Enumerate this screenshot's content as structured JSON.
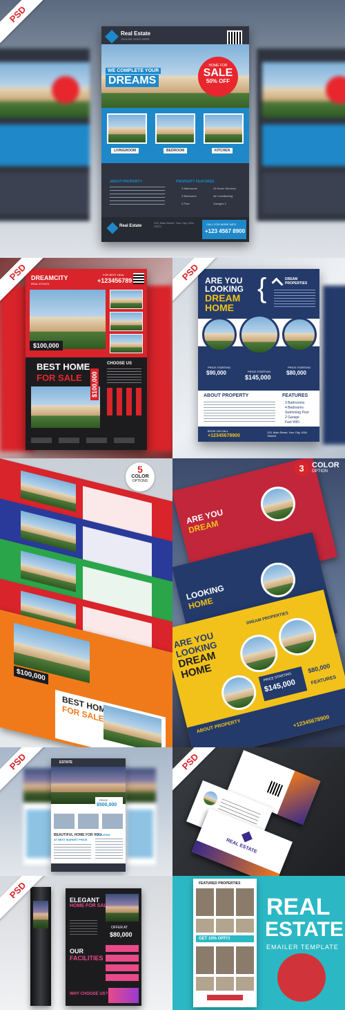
{
  "panel1": {
    "badge": "PSD",
    "logo_name": "Real Estate",
    "logo_tagline": "TAGLINE GOES HERE",
    "headline_small": "WE COMPLETE YOUR",
    "headline_big": "DREAMS",
    "sale_small": "HOME FOR",
    "sale_big": "SALE",
    "sale_off": "50% OFF",
    "rooms": [
      "LIVINGROOM",
      "BEDROOM",
      "KITCHEN"
    ],
    "about_title": "ABOUT PROPERTY",
    "features_title": "PROPERTY FEATURES",
    "features": [
      "3 Bathrooms",
      "24 Hours Services",
      "2 Bedrooms",
      "Air Conditioning",
      "2 Pool",
      "Garages 2"
    ],
    "footer_logo": "Real Estate",
    "address": "123, Main Street, Your City, USA 70071",
    "phone_label": "CALL FOR MORE INFO",
    "phone": "+123 4567 8900",
    "colors": {
      "dark": "#2f3440",
      "accent": "#1e88c9",
      "sale": "#e8262d"
    }
  },
  "panel2": {
    "badge": "PSD",
    "brand": "DREAMCITY",
    "brand_sub": "REAL ESTATE",
    "call_label": "FOR BEST DEAL",
    "phone": "+123456789",
    "price": "$100,000",
    "headline_1": "BEST HOME",
    "headline_2": "FOR SALE",
    "side_price": "$100,000",
    "section": "CHOOSE US",
    "colors": {
      "red": "#d8242a",
      "dark": "#1c1c1f"
    }
  },
  "panel3": {
    "badge": "PSD",
    "headline": [
      "ARE YOU",
      "LOOKING",
      "DREAM",
      "HOME"
    ],
    "brand": "DREAM PROPERTIES",
    "prices": [
      {
        "label": "PRICE STARTING",
        "value": "$90,000"
      },
      {
        "label": "PRICE STARTING",
        "value": "$145,000"
      },
      {
        "label": "PRICE STARTING",
        "value": "$80,000"
      }
    ],
    "about_title": "ABOUT PROPERTY",
    "features_title": "FEATURES",
    "features": [
      "3 Bathrooms",
      "4 Bedrooms",
      "Swimming Pool",
      "2 Garage",
      "Fast WiFi"
    ],
    "book_label": "BOOK ON CALL",
    "phone": "+12345678900",
    "address": "123, Main Street, Your City, USA 788423",
    "colors": {
      "navy": "#233a6b",
      "gold": "#f2c21b"
    }
  },
  "panel4": {
    "options_number": "5",
    "options_line1": "COLOR",
    "options_line2": "OPTIONS",
    "headline_1": "BEST HOME",
    "headline_2": "FOR SALE",
    "price": "$100,000",
    "flyer_colors": [
      "#d8242a",
      "#2a3a9a",
      "#2aa54a",
      "#d8242a",
      "#f07a1a"
    ]
  },
  "panel5": {
    "options_number": "3",
    "options_line1": "COLOR",
    "options_line2": "OPTION",
    "headline": [
      "ARE YOU",
      "LOOKING",
      "DREAM",
      "HOME"
    ],
    "brand": "DREAM PROPERTIES",
    "price_label": "PRICE STARTING",
    "price": "$145,000",
    "price_2": "$80,000",
    "about_title": "ABOUT PROPERTY",
    "features_title": "FEATURES",
    "phone": "+12345678900",
    "flyer_colors": [
      "#c2263a",
      "#233a6b",
      "#f2c21b"
    ]
  },
  "panel6": {
    "badge": "PSD",
    "logo": "ESTATE",
    "price_label": "PRICE",
    "price": "$500,000",
    "headline_1": "BEAUTIFUL HOME FOR YOU",
    "headline_2": "AT BEST MARKET PRICE",
    "facilities": "FACILITIES"
  },
  "panel7": {
    "badge": "PSD",
    "card_logo": "REAL ESTATE"
  },
  "panel8": {
    "badge": "PSD",
    "headline_1": "ELEGANT",
    "headline_2": "HOME FOR SALE",
    "offer_label": "OFFER AT",
    "offer_price": "$80,000",
    "facilities_1": "OUR",
    "facilities_2": "FACILITIES",
    "why": "WHY CHOOSE US?"
  },
  "panel9": {
    "email_title": "FEATURED PROPERTIES",
    "discount": "GET 10% OFF!!!",
    "title_1": "REAL",
    "title_2": "ESTATE",
    "subtitle": "EMAILER TEMPLATE",
    "colors": {
      "teal": "#2bb8c4",
      "red": "#d0343a"
    }
  }
}
